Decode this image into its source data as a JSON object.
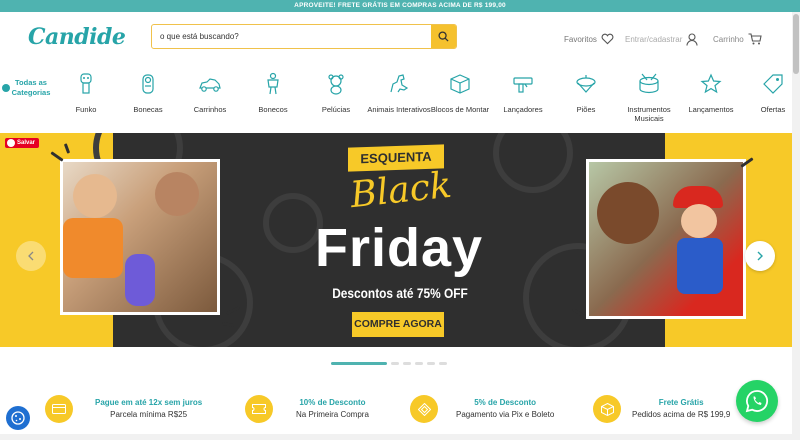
{
  "promo_bar": {
    "text": "APROVEITE! FRETE GRÁTIS EM COMPRAS ACIMA DE R$ 199,00"
  },
  "header": {
    "logo": "Candide",
    "search_placeholder": "o que está buscando?",
    "favorites_label": "Favoritos",
    "login_label": "Entrar/cadastrar",
    "cart_label": "Carrinho"
  },
  "categories": {
    "all_label_line1": "Todas as",
    "all_label_line2": "Categorias",
    "items": [
      {
        "label": "Funko",
        "icon": "funko-icon"
      },
      {
        "label": "Bonecas",
        "icon": "doll-icon"
      },
      {
        "label": "Carrinhos",
        "icon": "car-icon"
      },
      {
        "label": "Bonecos",
        "icon": "action-figure-icon"
      },
      {
        "label": "Pelúcias",
        "icon": "teddy-bear-icon"
      },
      {
        "label": "Animais Interativos",
        "icon": "dinosaur-icon"
      },
      {
        "label": "Blocos de Montar",
        "icon": "blocks-icon"
      },
      {
        "label": "Lançadores",
        "icon": "blaster-icon"
      },
      {
        "label": "Piões",
        "icon": "spinning-top-icon"
      },
      {
        "label": "Instrumentos Musicais",
        "icon": "drum-icon"
      },
      {
        "label": "Lançamentos",
        "icon": "star-icon"
      },
      {
        "label": "Ofertas",
        "icon": "tag-icon"
      }
    ]
  },
  "banner": {
    "save_label": "Salvar",
    "esquenta": "ESQUENTA",
    "black": "Black",
    "friday": "Friday",
    "discount": "Descontos até 75% OFF",
    "cta": "COMPRE AGORA",
    "slide_index": 1,
    "slide_count": 6
  },
  "benefits": [
    {
      "title": "Pague em até 12x sem juros",
      "subtitle": "Parcela mínima R$25",
      "icon": "credit-card-icon"
    },
    {
      "title": "10% de Desconto",
      "subtitle": "Na Primeira Compra",
      "icon": "ticket-icon"
    },
    {
      "title": "5% de Desconto",
      "subtitle": "Pagamento via Pix e Boleto",
      "icon": "pix-icon"
    },
    {
      "title": "Frete Grátis",
      "subtitle": "Pedidos acima de R$ 199,9",
      "icon": "package-icon"
    }
  ],
  "colors": {
    "teal": "#27a4a8",
    "yellow": "#f7c928",
    "dark": "#2f2f2f",
    "whatsapp": "#25d366"
  }
}
